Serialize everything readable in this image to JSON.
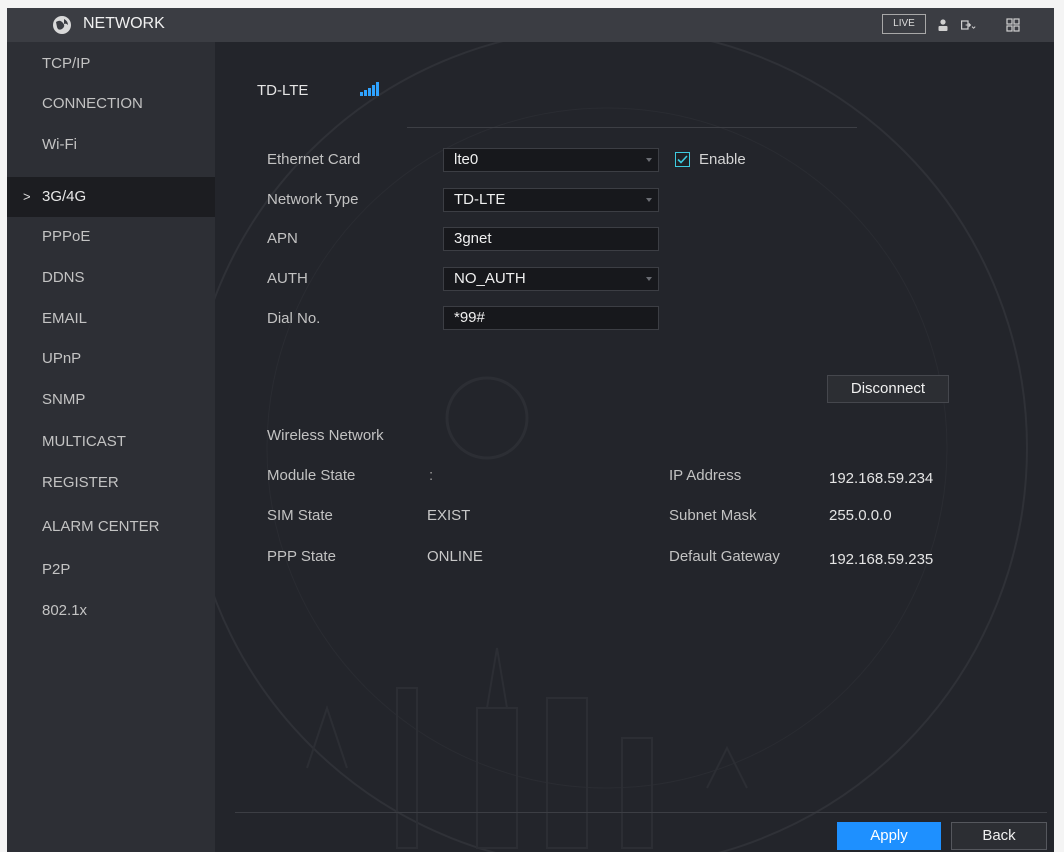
{
  "header": {
    "title": "NETWORK",
    "live_label": "LIVE",
    "icons": [
      "network-globe-icon",
      "user-icon",
      "logout-icon",
      "grid-icon"
    ]
  },
  "sidebar": {
    "items": [
      {
        "label": "TCP/IP"
      },
      {
        "label": "CONNECTION"
      },
      {
        "label": "Wi-Fi"
      },
      {
        "label": "3G/4G",
        "active": true
      },
      {
        "label": "PPPoE"
      },
      {
        "label": "DDNS"
      },
      {
        "label": "EMAIL"
      },
      {
        "label": "UPnP"
      },
      {
        "label": "SNMP"
      },
      {
        "label": "MULTICAST"
      },
      {
        "label": "REGISTER"
      },
      {
        "label": "ALARM CENTER"
      },
      {
        "label": "P2P"
      },
      {
        "label": "802.1x"
      }
    ],
    "active_marker": ">"
  },
  "main": {
    "heading": "TD-LTE",
    "form": {
      "ethernet_card": {
        "label": "Ethernet Card",
        "value": "lte0"
      },
      "enable": {
        "label": "Enable",
        "checked": true
      },
      "network_type": {
        "label": "Network Type",
        "value": "TD-LTE"
      },
      "apn": {
        "label": "APN",
        "value": "3gnet"
      },
      "auth": {
        "label": "AUTH",
        "value": "NO_AUTH"
      },
      "dial_no": {
        "label": "Dial No.",
        "value": "*99#"
      }
    },
    "disconnect_label": "Disconnect",
    "wireless": {
      "heading": "Wireless Network",
      "module_state": {
        "label": "Module State",
        "value": ":"
      },
      "sim_state": {
        "label": "SIM State",
        "value": "EXIST"
      },
      "ppp_state": {
        "label": "PPP State",
        "value": "ONLINE"
      },
      "ip_address": {
        "label": "IP Address",
        "value": "192.168.59.234"
      },
      "subnet_mask": {
        "label": "Subnet Mask",
        "value": "255.0.0.0"
      },
      "default_gateway": {
        "label": "Default Gateway",
        "value": "192.168.59.235"
      }
    },
    "apply_label": "Apply",
    "back_label": "Back"
  },
  "colors": {
    "accent": "#1e90ff",
    "background": "#23252b",
    "sidebar": "#2d2f35",
    "topbar": "#3b3d43",
    "checkbox": "#3ecbe0"
  }
}
